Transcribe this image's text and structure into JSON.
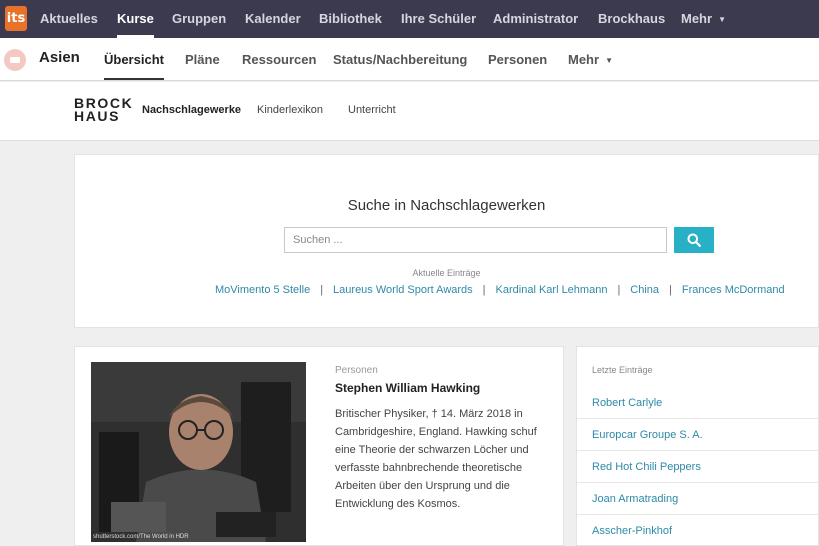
{
  "topnav": {
    "logo_text": "its",
    "items": [
      "Aktuelles",
      "Kurse",
      "Gruppen",
      "Kalender",
      "Bibliothek",
      "Ihre Schüler",
      "Administrator",
      "Brockhaus",
      "Mehr"
    ],
    "active_index": 1
  },
  "course": {
    "title": "Asien",
    "tabs": [
      "Übersicht",
      "Pläne",
      "Ressourcen",
      "Status/Nachbereitung",
      "Personen",
      "Mehr"
    ],
    "active_index": 0
  },
  "brockhaus": {
    "logo_line1": "BROCK",
    "logo_line2": "HAUS",
    "nav": [
      "Nachschlagewerke",
      "Kinderlexikon",
      "Unterricht"
    ],
    "active_index": 0
  },
  "search": {
    "title": "Suche in Nachschlagewerken",
    "placeholder": "Suchen ...",
    "value": "",
    "recent_label": "Aktuelle Einträge",
    "trending": [
      "MoVimento 5 Stelle",
      "Laureus World Sport Awards",
      "Kardinal Karl Lehmann",
      "China",
      "Frances McDormand"
    ],
    "separator": "|"
  },
  "article": {
    "category": "Personen",
    "title": "Stephen William Hawking",
    "body": "Britischer Physiker, † 14. März 2018 in Cambridgeshire, England. Hawking schuf eine Theorie der schwarzen Löcher und verfasste bahnbrechende theoretische Arbeiten über den Ursprung und die Entwicklung des Kosmos.",
    "photo_credit": "shutterstock.com/The World in HDR"
  },
  "recent_entries": {
    "heading": "Letzte Einträge",
    "items": [
      "Robert Carlyle",
      "Europcar Groupe S. A.",
      "Red Hot Chili Peppers",
      "Joan Armatrading",
      "Asscher-Pinkhof"
    ]
  },
  "colors": {
    "topnav_bg": "#3c3a4e",
    "logo_orange": "#e8722a",
    "accent_teal": "#27b0c6",
    "link": "#2e8aa8"
  }
}
